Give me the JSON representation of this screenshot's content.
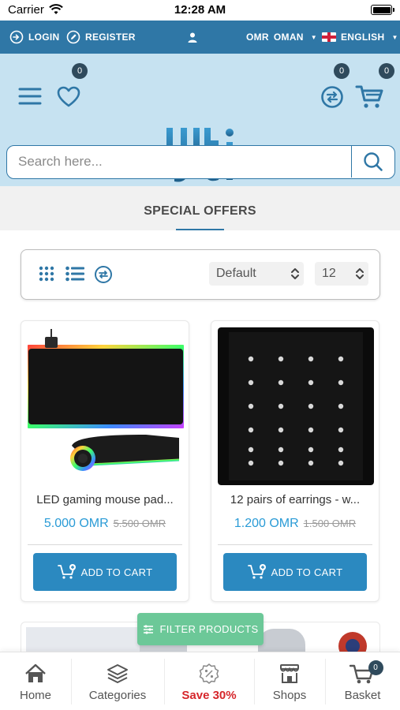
{
  "status_bar": {
    "carrier": "Carrier",
    "time": "12:28 AM"
  },
  "top_bar": {
    "login_label": "LOGIN",
    "register_label": "REGISTER",
    "currency_label": "OMR",
    "country_label": "OMAN",
    "language_label": "ENGLISH"
  },
  "header": {
    "wishlist_count": "0",
    "compare_count": "0",
    "cart_count": "0",
    "logo_icon": "brand-logo-icon"
  },
  "search": {
    "placeholder": "Search here..."
  },
  "section": {
    "title": "SPECIAL OFFERS"
  },
  "toolbar": {
    "sort_value": "Default",
    "per_page_value": "12"
  },
  "products": [
    {
      "name": "LED gaming mouse pad...",
      "price": "5.000 OMR",
      "old_price": "5.500 OMR",
      "add_to_cart_label": "ADD TO CART"
    },
    {
      "name": "12 pairs of earrings - w...",
      "price": "1.200 OMR",
      "old_price": "1.500 OMR",
      "add_to_cart_label": "ADD TO CART"
    }
  ],
  "filter": {
    "label": "FILTER PRODUCTS"
  },
  "bottom_nav": {
    "home": "Home",
    "categories": "Categories",
    "save": "Save 30%",
    "shops": "Shops",
    "basket": "Basket",
    "basket_count": "0"
  },
  "colors": {
    "top_bar": "#2f77a6",
    "header_bg": "#c6e2f1",
    "accent": "#2b89c0",
    "price": "#2a9bd6",
    "filter": "#6cc898",
    "save": "#d6262b"
  }
}
